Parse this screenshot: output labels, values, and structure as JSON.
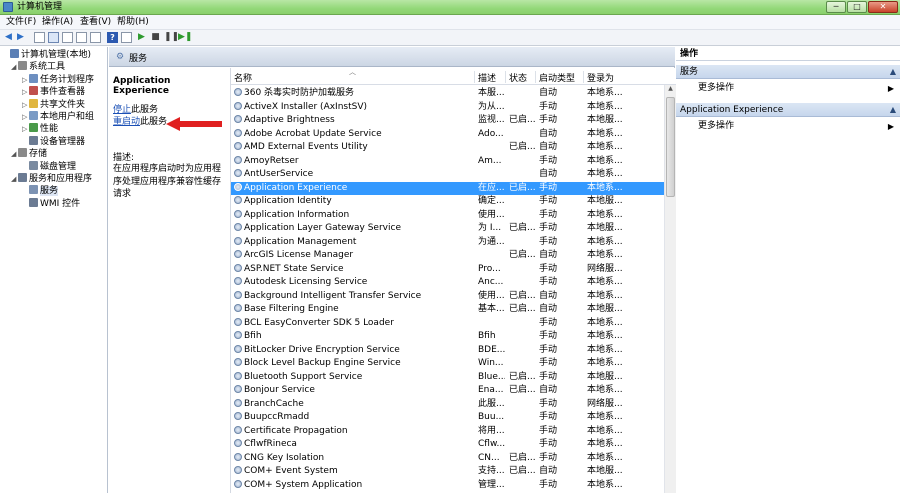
{
  "window": {
    "title": "计算机管理",
    "controls": [
      "─",
      "□",
      "✕"
    ]
  },
  "menu": [
    "文件(F)",
    "操作(A)",
    "查看(V)",
    "帮助(H)"
  ],
  "tree": {
    "items": [
      {
        "label": "计算机管理(本地)",
        "level": 0,
        "expander": "",
        "icon": "computer-icon",
        "color": "#5b7fb5"
      },
      {
        "label": "系统工具",
        "level": 1,
        "expander": "◢",
        "icon": "tools-icon",
        "color": "#8a8a8a"
      },
      {
        "label": "任务计划程序",
        "level": 2,
        "expander": "▷",
        "icon": "clock-icon",
        "color": "#6d8fc0"
      },
      {
        "label": "事件查看器",
        "level": 2,
        "expander": "▷",
        "icon": "event-viewer-icon",
        "color": "#c0504d"
      },
      {
        "label": "共享文件夹",
        "level": 2,
        "expander": "▷",
        "icon": "folder-icon",
        "color": "#e0b640"
      },
      {
        "label": "本地用户和组",
        "level": 2,
        "expander": "▷",
        "icon": "users-icon",
        "color": "#7a9bc5"
      },
      {
        "label": "性能",
        "level": 2,
        "expander": "▷",
        "icon": "performance-icon",
        "color": "#4a9a4a"
      },
      {
        "label": "设备管理器",
        "level": 2,
        "expander": "",
        "icon": "device-manager-icon",
        "color": "#6b7b93"
      },
      {
        "label": "存储",
        "level": 1,
        "expander": "◢",
        "icon": "storage-icon",
        "color": "#8a8a8a"
      },
      {
        "label": "磁盘管理",
        "level": 2,
        "expander": "",
        "icon": "disk-icon",
        "color": "#7a8aa0"
      },
      {
        "label": "服务和应用程序",
        "level": 1,
        "expander": "◢",
        "icon": "services-apps-icon",
        "color": "#6b7b93"
      },
      {
        "label": "服务",
        "level": 2,
        "expander": "",
        "icon": "gear-icon",
        "color": "#7d93b3",
        "selected": true
      },
      {
        "label": "WMI 控件",
        "level": 2,
        "expander": "",
        "icon": "wmi-icon",
        "color": "#6b7b93"
      }
    ]
  },
  "center": {
    "header": "服务",
    "selected_service": "Application Experience",
    "stop_link": "停止",
    "stop_suffix": "此服务",
    "restart_link": "重启动",
    "restart_suffix": "此服务",
    "desc_label": "描述:",
    "desc_text": "在应用程序启动时为应用程序处理应用程序兼容性缓存请求"
  },
  "columns": {
    "name": "名称",
    "desc": "描述",
    "status": "状态",
    "startup": "启动类型",
    "logon": "登录为"
  },
  "services": [
    {
      "name": "360 杀毒实时防护加载服务",
      "desc": "本服...",
      "status": "",
      "startup": "自动",
      "logon": "本地系..."
    },
    {
      "name": "ActiveX Installer (AxInstSV)",
      "desc": "为从...",
      "status": "",
      "startup": "手动",
      "logon": "本地系..."
    },
    {
      "name": "Adaptive Brightness",
      "desc": "监视...",
      "status": "已启...",
      "startup": "手动",
      "logon": "本地服..."
    },
    {
      "name": "Adobe Acrobat Update Service",
      "desc": "Ado...",
      "status": "",
      "startup": "自动",
      "logon": "本地系..."
    },
    {
      "name": "AMD External Events Utility",
      "desc": "",
      "status": "已启...",
      "startup": "自动",
      "logon": "本地系..."
    },
    {
      "name": "AmoyRetser",
      "desc": "Am...",
      "status": "",
      "startup": "手动",
      "logon": "本地系..."
    },
    {
      "name": "AntUserService",
      "desc": "",
      "status": "",
      "startup": "自动",
      "logon": "本地系..."
    },
    {
      "name": "Application Experience",
      "desc": "在应...",
      "status": "已启...",
      "startup": "手动",
      "logon": "本地系...",
      "selected": true
    },
    {
      "name": "Application Identity",
      "desc": "确定...",
      "status": "",
      "startup": "手动",
      "logon": "本地服..."
    },
    {
      "name": "Application Information",
      "desc": "使用...",
      "status": "",
      "startup": "手动",
      "logon": "本地系..."
    },
    {
      "name": "Application Layer Gateway Service",
      "desc": "为 I...",
      "status": "已启...",
      "startup": "手动",
      "logon": "本地服..."
    },
    {
      "name": "Application Management",
      "desc": "为通...",
      "status": "",
      "startup": "手动",
      "logon": "本地系..."
    },
    {
      "name": "ArcGIS License Manager",
      "desc": "",
      "status": "已启...",
      "startup": "自动",
      "logon": "本地系..."
    },
    {
      "name": "ASP.NET State Service",
      "desc": "Pro...",
      "status": "",
      "startup": "手动",
      "logon": "网络服..."
    },
    {
      "name": "Autodesk Licensing Service",
      "desc": "Anc...",
      "status": "",
      "startup": "手动",
      "logon": "本地系..."
    },
    {
      "name": "Background Intelligent Transfer Service",
      "desc": "使用...",
      "status": "已启...",
      "startup": "自动",
      "logon": "本地系..."
    },
    {
      "name": "Base Filtering Engine",
      "desc": "基本...",
      "status": "已启...",
      "startup": "自动",
      "logon": "本地服..."
    },
    {
      "name": "BCL EasyConverter SDK 5 Loader",
      "desc": "",
      "status": "",
      "startup": "手动",
      "logon": "本地系..."
    },
    {
      "name": "Bfih",
      "desc": "Bfih",
      "status": "",
      "startup": "手动",
      "logon": "本地系..."
    },
    {
      "name": "BitLocker Drive Encryption Service",
      "desc": "BDE...",
      "status": "",
      "startup": "手动",
      "logon": "本地系..."
    },
    {
      "name": "Block Level Backup Engine Service",
      "desc": "Win...",
      "status": "",
      "startup": "手动",
      "logon": "本地系..."
    },
    {
      "name": "Bluetooth Support Service",
      "desc": "Blue...",
      "status": "已启...",
      "startup": "手动",
      "logon": "本地服..."
    },
    {
      "name": "Bonjour Service",
      "desc": "Ena...",
      "status": "已启...",
      "startup": "自动",
      "logon": "本地系..."
    },
    {
      "name": "BranchCache",
      "desc": "此服...",
      "status": "",
      "startup": "手动",
      "logon": "网络服..."
    },
    {
      "name": "BuupccRmadd",
      "desc": "Buu...",
      "status": "",
      "startup": "手动",
      "logon": "本地系..."
    },
    {
      "name": "Certificate Propagation",
      "desc": "将用...",
      "status": "",
      "startup": "手动",
      "logon": "本地系..."
    },
    {
      "name": "CflwfRineca",
      "desc": "Cflw...",
      "status": "",
      "startup": "手动",
      "logon": "本地系..."
    },
    {
      "name": "CNG Key Isolation",
      "desc": "CN...",
      "status": "已启...",
      "startup": "手动",
      "logon": "本地系..."
    },
    {
      "name": "COM+ Event System",
      "desc": "支持...",
      "status": "已启...",
      "startup": "自动",
      "logon": "本地服..."
    },
    {
      "name": "COM+ System Application",
      "desc": "管理...",
      "status": "",
      "startup": "手动",
      "logon": "本地系..."
    }
  ],
  "actions": {
    "header": "操作",
    "sections": [
      {
        "title": "服务",
        "items": [
          "更多操作"
        ]
      },
      {
        "title": "Application Experience",
        "items": [
          "更多操作"
        ]
      }
    ]
  },
  "colors": {
    "selection": "#3399ff",
    "link": "#1a4fb5",
    "arrow": "#e02020",
    "titlebar": "#93d879"
  }
}
